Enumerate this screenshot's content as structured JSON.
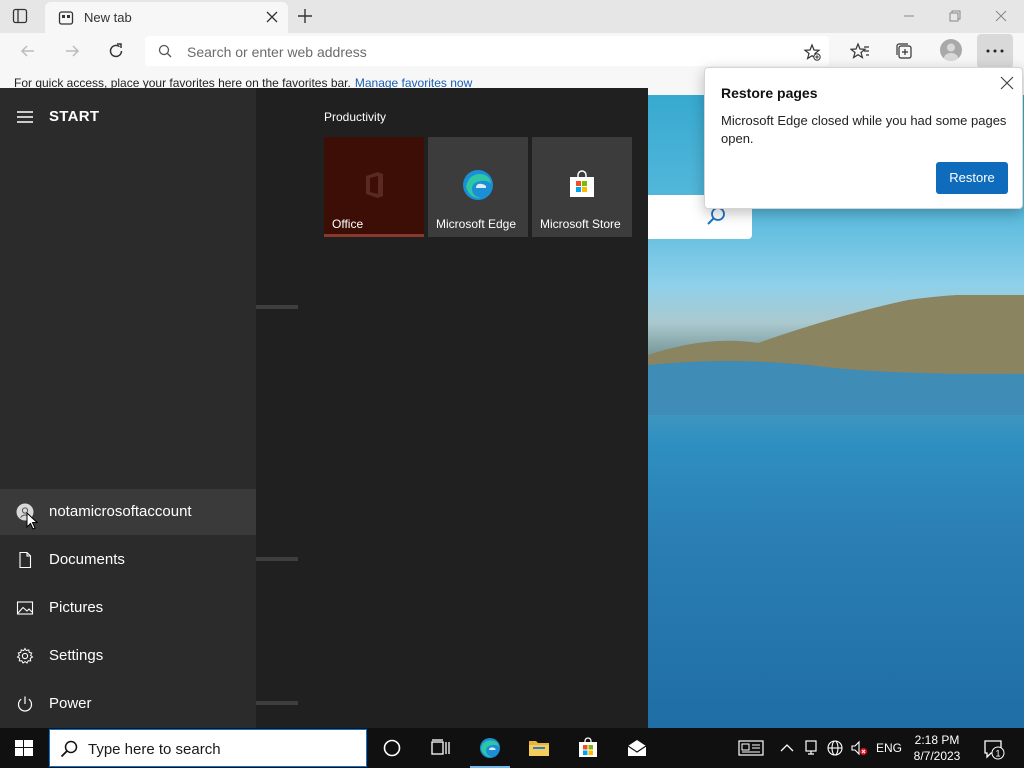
{
  "browser": {
    "tab_title": "New tab",
    "address_placeholder": "Search or enter web address",
    "favorites_prompt": "For quick access, place your favorites here on the favorites bar.",
    "favorites_link": "Manage favorites now"
  },
  "restore_popup": {
    "title": "Restore pages",
    "message": "Microsoft Edge closed while you had some pages open.",
    "button": "Restore"
  },
  "start_menu": {
    "title": "START",
    "rail_items": [
      {
        "label": "notamicrosoftaccount",
        "icon": "user-icon"
      },
      {
        "label": "Documents",
        "icon": "document-icon"
      },
      {
        "label": "Pictures",
        "icon": "pictures-icon"
      },
      {
        "label": "Settings",
        "icon": "gear-icon"
      },
      {
        "label": "Power",
        "icon": "power-icon"
      }
    ],
    "group_title": "Productivity",
    "tiles": [
      {
        "label": "Office",
        "icon": "office-icon",
        "color": "#3d0e06"
      },
      {
        "label": "Microsoft Edge",
        "icon": "edge-icon",
        "color": "#3c3c3c"
      },
      {
        "label": "Microsoft Store",
        "icon": "store-icon",
        "color": "#3c3c3c"
      }
    ]
  },
  "taskbar": {
    "search_placeholder": "Type here to search",
    "apps": [
      "cortana-icon",
      "task-view-icon",
      "edge-icon",
      "file-explorer-icon",
      "store-icon",
      "mail-icon"
    ],
    "language": "ENG",
    "time": "2:18 PM",
    "date": "8/7/2023",
    "notification_count": "1"
  },
  "colors": {
    "accent": "#0f6cbd",
    "taskbar": "#101010",
    "start_bg": "#202020",
    "start_rail": "#2b2b2b"
  }
}
